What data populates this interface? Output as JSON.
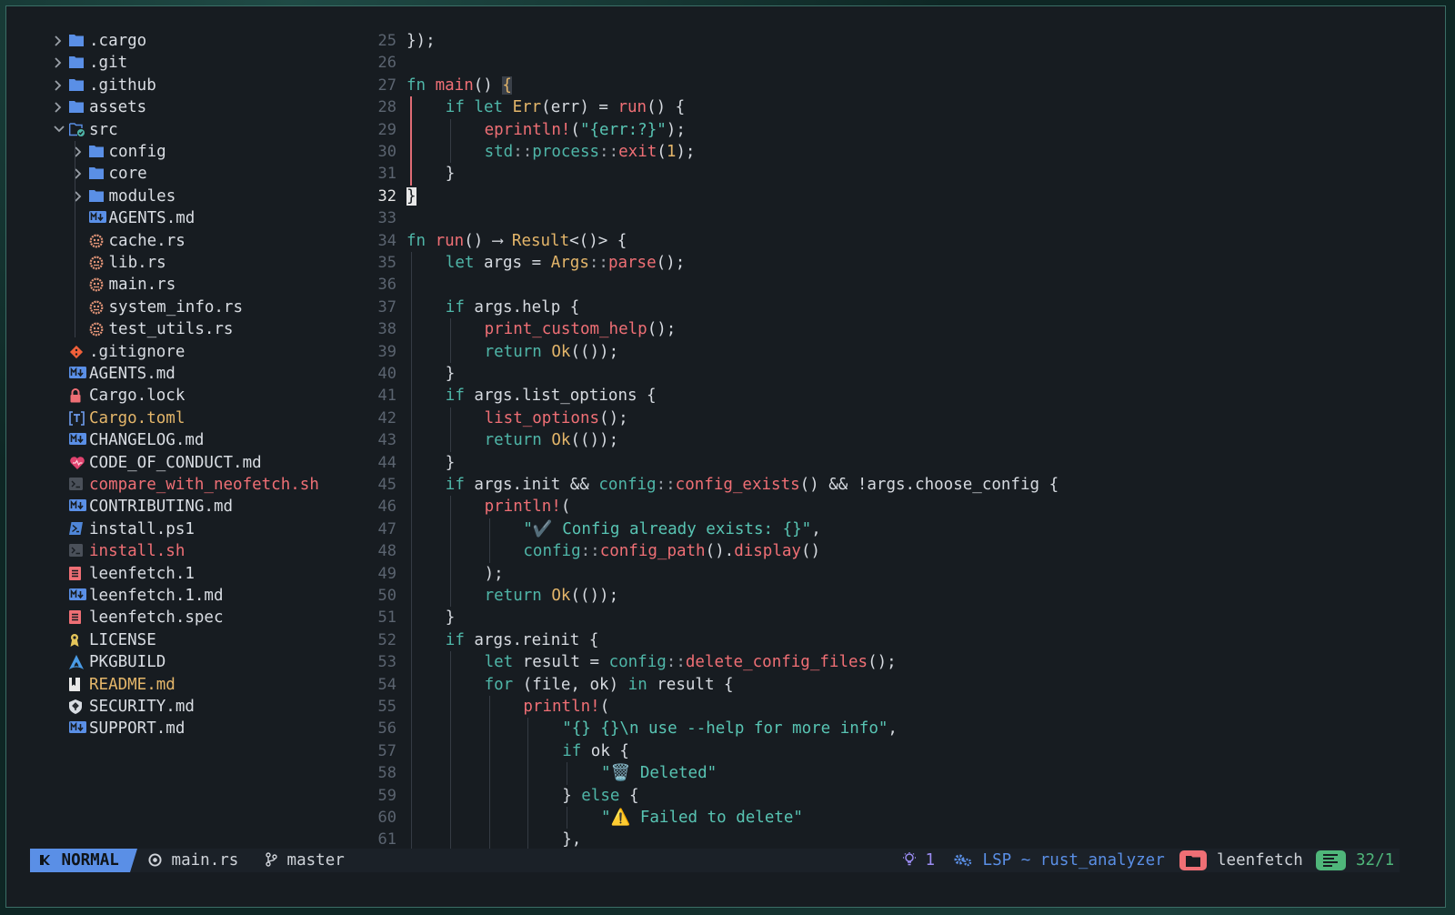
{
  "explorer": {
    "items": [
      {
        "label": ".cargo",
        "depth": 0,
        "kind": "folder",
        "expanded": false,
        "color": "#d9dde3"
      },
      {
        "label": ".git",
        "depth": 0,
        "kind": "folder",
        "expanded": false,
        "color": "#d9dde3"
      },
      {
        "label": ".github",
        "depth": 0,
        "kind": "folder",
        "expanded": false,
        "color": "#d9dde3"
      },
      {
        "label": "assets",
        "depth": 0,
        "kind": "folder",
        "expanded": false,
        "color": "#d9dde3"
      },
      {
        "label": "src",
        "depth": 0,
        "kind": "folder-open",
        "expanded": true,
        "color": "#d9dde3"
      },
      {
        "label": "config",
        "depth": 1,
        "kind": "folder",
        "expanded": false,
        "color": "#d9dde3"
      },
      {
        "label": "core",
        "depth": 1,
        "kind": "folder",
        "expanded": false,
        "color": "#d9dde3"
      },
      {
        "label": "modules",
        "depth": 1,
        "kind": "folder",
        "expanded": false,
        "color": "#d9dde3"
      },
      {
        "label": "AGENTS.md",
        "depth": 1,
        "kind": "markdown",
        "color": "#d9dde3"
      },
      {
        "label": "cache.rs",
        "depth": 1,
        "kind": "rust",
        "color": "#d9dde3"
      },
      {
        "label": "lib.rs",
        "depth": 1,
        "kind": "rust",
        "color": "#d9dde3"
      },
      {
        "label": "main.rs",
        "depth": 1,
        "kind": "rust",
        "color": "#d9dde3"
      },
      {
        "label": "system_info.rs",
        "depth": 1,
        "kind": "rust",
        "color": "#d9dde3"
      },
      {
        "label": "test_utils.rs",
        "depth": 1,
        "kind": "rust",
        "color": "#d9dde3"
      },
      {
        "label": ".gitignore",
        "depth": 0,
        "kind": "git",
        "color": "#d9dde3"
      },
      {
        "label": "AGENTS.md",
        "depth": 0,
        "kind": "markdown",
        "color": "#d9dde3"
      },
      {
        "label": "Cargo.lock",
        "depth": 0,
        "kind": "lock",
        "color": "#d9dde3"
      },
      {
        "label": "Cargo.toml",
        "depth": 0,
        "kind": "toml",
        "color": "#e4b66a"
      },
      {
        "label": "CHANGELOG.md",
        "depth": 0,
        "kind": "markdown",
        "color": "#d9dde3"
      },
      {
        "label": "CODE_OF_CONDUCT.md",
        "depth": 0,
        "kind": "heart",
        "color": "#d9dde3"
      },
      {
        "label": "compare_with_neofetch.sh",
        "depth": 0,
        "kind": "shell",
        "color": "#ef6f75"
      },
      {
        "label": "CONTRIBUTING.md",
        "depth": 0,
        "kind": "markdown",
        "color": "#d9dde3"
      },
      {
        "label": "install.ps1",
        "depth": 0,
        "kind": "powershell",
        "color": "#d9dde3"
      },
      {
        "label": "install.sh",
        "depth": 0,
        "kind": "shell",
        "color": "#ef6f75"
      },
      {
        "label": "leenfetch.1",
        "depth": 0,
        "kind": "doc",
        "color": "#d9dde3"
      },
      {
        "label": "leenfetch.1.md",
        "depth": 0,
        "kind": "markdown",
        "color": "#d9dde3"
      },
      {
        "label": "leenfetch.spec",
        "depth": 0,
        "kind": "doc",
        "color": "#d9dde3"
      },
      {
        "label": "LICENSE",
        "depth": 0,
        "kind": "license",
        "color": "#d9dde3"
      },
      {
        "label": "PKGBUILD",
        "depth": 0,
        "kind": "arch",
        "color": "#d9dde3"
      },
      {
        "label": "README.md",
        "depth": 0,
        "kind": "readme",
        "color": "#e4b66a"
      },
      {
        "label": "SECURITY.md",
        "depth": 0,
        "kind": "shield",
        "color": "#d9dde3"
      },
      {
        "label": "SUPPORT.md",
        "depth": 0,
        "kind": "markdown",
        "color": "#d9dde3"
      }
    ]
  },
  "editor": {
    "current_line": 32,
    "lines": [
      {
        "n": 25,
        "indent": 0,
        "tokens": [
          [
            "});",
            "def"
          ]
        ]
      },
      {
        "n": 26,
        "indent": 0,
        "tokens": []
      },
      {
        "n": 27,
        "indent": 0,
        "tokens": [
          [
            "fn ",
            "kw"
          ],
          [
            "main",
            "fn"
          ],
          [
            "() ",
            "def"
          ],
          [
            "{",
            "brace-hl"
          ]
        ]
      },
      {
        "n": 28,
        "indent": 1,
        "tokens": [
          [
            "if let ",
            "kw"
          ],
          [
            "Err",
            "ty"
          ],
          [
            "(err) = ",
            "def"
          ],
          [
            "run",
            "fn"
          ],
          [
            "() {",
            "def"
          ]
        ]
      },
      {
        "n": 29,
        "indent": 2,
        "tokens": [
          [
            "eprintln!",
            "mac"
          ],
          [
            "(",
            "def"
          ],
          [
            "\"{err:?}\"",
            "str"
          ],
          [
            ");",
            "def"
          ]
        ]
      },
      {
        "n": 30,
        "indent": 2,
        "tokens": [
          [
            "std",
            "ns"
          ],
          [
            "::",
            "punct"
          ],
          [
            "process",
            "ns"
          ],
          [
            "::",
            "punct"
          ],
          [
            "exit",
            "fn"
          ],
          [
            "(",
            "def"
          ],
          [
            "1",
            "num"
          ],
          [
            ");",
            "def"
          ]
        ]
      },
      {
        "n": 31,
        "indent": 1,
        "tokens": [
          [
            "}",
            "def"
          ]
        ]
      },
      {
        "n": 32,
        "indent": 0,
        "tokens": [
          [
            "}",
            "cursor"
          ]
        ]
      },
      {
        "n": 33,
        "indent": 0,
        "tokens": []
      },
      {
        "n": 34,
        "indent": 0,
        "tokens": [
          [
            "fn ",
            "kw"
          ],
          [
            "run",
            "fn"
          ],
          [
            "() ",
            "def"
          ],
          [
            "⟶ ",
            "op"
          ],
          [
            "Result",
            "ty"
          ],
          [
            "<()> {",
            "def"
          ]
        ]
      },
      {
        "n": 35,
        "indent": 1,
        "tokens": [
          [
            "let ",
            "kw"
          ],
          [
            "args = ",
            "def"
          ],
          [
            "Args",
            "ty"
          ],
          [
            "::",
            "punct"
          ],
          [
            "parse",
            "fn"
          ],
          [
            "();",
            "def"
          ]
        ]
      },
      {
        "n": 36,
        "indent": 0,
        "tokens": []
      },
      {
        "n": 37,
        "indent": 1,
        "tokens": [
          [
            "if ",
            "kw"
          ],
          [
            "args.help {",
            "def"
          ]
        ]
      },
      {
        "n": 38,
        "indent": 2,
        "tokens": [
          [
            "print_custom_help",
            "fn"
          ],
          [
            "();",
            "def"
          ]
        ]
      },
      {
        "n": 39,
        "indent": 2,
        "tokens": [
          [
            "return ",
            "kw"
          ],
          [
            "Ok",
            "ty"
          ],
          [
            "(());",
            "def"
          ]
        ]
      },
      {
        "n": 40,
        "indent": 1,
        "tokens": [
          [
            "}",
            "def"
          ]
        ]
      },
      {
        "n": 41,
        "indent": 1,
        "tokens": [
          [
            "if ",
            "kw"
          ],
          [
            "args.list_options {",
            "def"
          ]
        ]
      },
      {
        "n": 42,
        "indent": 2,
        "tokens": [
          [
            "list_options",
            "fn"
          ],
          [
            "();",
            "def"
          ]
        ]
      },
      {
        "n": 43,
        "indent": 2,
        "tokens": [
          [
            "return ",
            "kw"
          ],
          [
            "Ok",
            "ty"
          ],
          [
            "(());",
            "def"
          ]
        ]
      },
      {
        "n": 44,
        "indent": 1,
        "tokens": [
          [
            "}",
            "def"
          ]
        ]
      },
      {
        "n": 45,
        "indent": 1,
        "tokens": [
          [
            "if ",
            "kw"
          ],
          [
            "args.init && ",
            "def"
          ],
          [
            "config",
            "ns"
          ],
          [
            "::",
            "punct"
          ],
          [
            "config_exists",
            "fn"
          ],
          [
            "() && !args.choose_config {",
            "def"
          ]
        ]
      },
      {
        "n": 46,
        "indent": 2,
        "tokens": [
          [
            "println!",
            "mac"
          ],
          [
            "(",
            "def"
          ]
        ]
      },
      {
        "n": 47,
        "indent": 3,
        "tokens": [
          [
            "\"✔️ Config already exists: {}\"",
            "str"
          ],
          [
            ",",
            "def"
          ]
        ]
      },
      {
        "n": 48,
        "indent": 3,
        "tokens": [
          [
            "config",
            "ns"
          ],
          [
            "::",
            "punct"
          ],
          [
            "config_path",
            "fn"
          ],
          [
            "().",
            "def"
          ],
          [
            "display",
            "fn"
          ],
          [
            "()",
            "def"
          ]
        ]
      },
      {
        "n": 49,
        "indent": 2,
        "tokens": [
          [
            ");",
            "def"
          ]
        ]
      },
      {
        "n": 50,
        "indent": 2,
        "tokens": [
          [
            "return ",
            "kw"
          ],
          [
            "Ok",
            "ty"
          ],
          [
            "(());",
            "def"
          ]
        ]
      },
      {
        "n": 51,
        "indent": 1,
        "tokens": [
          [
            "}",
            "def"
          ]
        ]
      },
      {
        "n": 52,
        "indent": 1,
        "tokens": [
          [
            "if ",
            "kw"
          ],
          [
            "args.reinit {",
            "def"
          ]
        ]
      },
      {
        "n": 53,
        "indent": 2,
        "tokens": [
          [
            "let ",
            "kw"
          ],
          [
            "result = ",
            "def"
          ],
          [
            "config",
            "ns"
          ],
          [
            "::",
            "punct"
          ],
          [
            "delete_config_files",
            "fn"
          ],
          [
            "();",
            "def"
          ]
        ]
      },
      {
        "n": 54,
        "indent": 2,
        "tokens": [
          [
            "for ",
            "kw"
          ],
          [
            "(file, ok) ",
            "def"
          ],
          [
            "in ",
            "kw"
          ],
          [
            "result {",
            "def"
          ]
        ]
      },
      {
        "n": 55,
        "indent": 3,
        "tokens": [
          [
            "println!",
            "mac"
          ],
          [
            "(",
            "def"
          ]
        ]
      },
      {
        "n": 56,
        "indent": 4,
        "tokens": [
          [
            "\"{} {}\\n use --help for more info\"",
            "str"
          ],
          [
            ",",
            "def"
          ]
        ]
      },
      {
        "n": 57,
        "indent": 4,
        "tokens": [
          [
            "if ",
            "kw"
          ],
          [
            "ok {",
            "def"
          ]
        ]
      },
      {
        "n": 58,
        "indent": 5,
        "tokens": [
          [
            "\"🗑️ Deleted\"",
            "str"
          ]
        ]
      },
      {
        "n": 59,
        "indent": 4,
        "tokens": [
          [
            "} ",
            "def"
          ],
          [
            "else ",
            "kw"
          ],
          [
            "{",
            "def"
          ]
        ]
      },
      {
        "n": 60,
        "indent": 5,
        "tokens": [
          [
            "\"⚠️ Failed to delete\"",
            "str"
          ]
        ]
      },
      {
        "n": 61,
        "indent": 4,
        "tokens": [
          [
            "},",
            "def"
          ]
        ]
      }
    ]
  },
  "statusbar": {
    "mode": "NORMAL",
    "file": "main.rs",
    "branch": "master",
    "diagnostics": "1",
    "lsp": "LSP ~ rust_analyzer",
    "project": "leenfetch",
    "position": "32/1"
  },
  "colors": {
    "background": "#171c21",
    "accent_mode": "#5a8fe6",
    "keyword": "#4fb6a8",
    "function": "#ef6f75",
    "type": "#e4b66a",
    "string": "#58c4b3",
    "folder": "#5a8fe6",
    "project_pill": "#ef6f75",
    "position_pill": "#4fb67a"
  }
}
